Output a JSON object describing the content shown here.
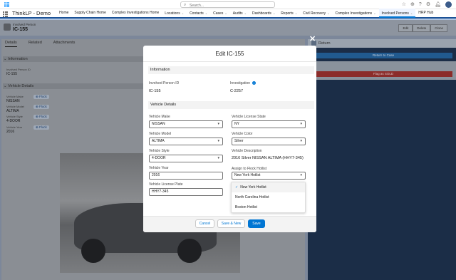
{
  "header": {
    "search_placeholder": "Search...",
    "icons": [
      "star-icon",
      "add-icon",
      "help-icon",
      "setup-icon",
      "bell-icon",
      "avatar"
    ]
  },
  "nav": {
    "app_name": "ThinkLP - Demo",
    "items": [
      {
        "label": "Home",
        "chevron": false
      },
      {
        "label": "Supply Chain Home",
        "chevron": false
      },
      {
        "label": "Complex Investigations Home",
        "chevron": false
      },
      {
        "label": "Locations",
        "chevron": true
      },
      {
        "label": "Contacts",
        "chevron": true
      },
      {
        "label": "Cases",
        "chevron": true
      },
      {
        "label": "Audits",
        "chevron": true
      },
      {
        "label": "Dashboards",
        "chevron": true
      },
      {
        "label": "Reports",
        "chevron": true
      },
      {
        "label": "Civil Recovery",
        "chevron": true
      },
      {
        "label": "Complex Investigations",
        "chevron": true
      },
      {
        "label": "Involved Persons",
        "chevron": true,
        "active": true
      },
      {
        "label": "HRP Hub",
        "chevron": false
      }
    ],
    "chevron_glyph": "⌄"
  },
  "record": {
    "type": "Involved Person",
    "name": "IC-155",
    "buttons": [
      "Edit",
      "Delete",
      "Clone"
    ]
  },
  "detail": {
    "tabs": [
      "Details",
      "Related",
      "Attachments"
    ],
    "info_section": "Information",
    "person_id_label": "Involved Person ID",
    "person_id_value": "IC-155",
    "vehicle_section": "Vehicle Details",
    "make_label": "Vehicle Make",
    "make_value": "NISSAN",
    "model_label": "Vehicle Model",
    "model_value": "ALTIMA",
    "style_label": "Vehicle Style",
    "style_value": "4-DOOR",
    "year_label": "Vehicle Year",
    "year_value": "2016",
    "flock_label": "Flock"
  },
  "right_panel": {
    "title": "Return",
    "btn1": "Return to Case",
    "btn2": "Flag as SOLD"
  },
  "modal": {
    "title": "Edit IC-155",
    "info_section": "Information",
    "person_id_label": "Involved Person ID",
    "person_id_value": "IC-155",
    "investigation_label": "Investigation",
    "investigation_value": "C-2257",
    "vehicle_section": "Vehicle Details",
    "make_label": "Vehicle Make",
    "make_value": "NISSAN",
    "license_state_label": "Vehicle License State",
    "license_state_value": "NY",
    "model_label": "Vehicle Model",
    "model_value": "ALTIMA",
    "color_label": "Vehicle Color",
    "color_value": "Silver",
    "style_label": "Vehicle Style",
    "style_value": "4-DOOR",
    "description_label": "Vehicle Description",
    "description_value": "2016 Silver NISSAN ALTIMA (HHY7-345)",
    "year_label": "Vehicle Year",
    "year_value": "2016",
    "hotlist_label": "Assign to Flock Hotlist",
    "hotlist_value": "New York Hotlist",
    "plate_label": "Vehicle License Plate",
    "plate_value": "HHY7-345",
    "hotlist_options": [
      "New York Hotlist",
      "North Carolina Hotlist",
      "Boston Hotlist"
    ],
    "cancel": "Cancel",
    "save_new": "Save & New",
    "save": "Save"
  },
  "colors": {
    "brand": "#0176d3",
    "nav_active_border": "#1b5297"
  }
}
